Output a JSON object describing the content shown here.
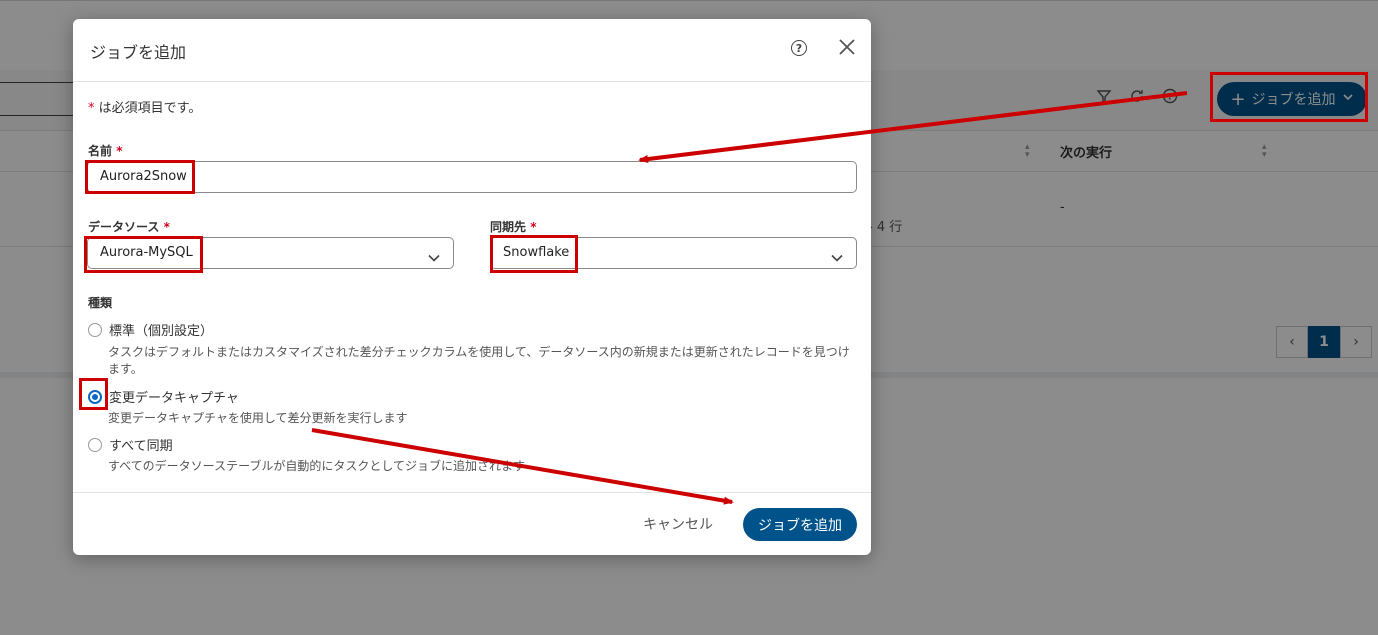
{
  "background": {
    "toolbar": {
      "add_job_label": "ジョブを追加"
    },
    "table": {
      "next_run_header": "次の実行",
      "next_run_value": "-",
      "rows_text": "- 4 行"
    },
    "pagination": {
      "prev": "‹",
      "current_page": "1",
      "next": "›"
    }
  },
  "modal": {
    "title": "ジョブを追加",
    "required_note": {
      "mark": "*",
      "text": " は必須項目です。"
    },
    "fields": {
      "name": {
        "label": "名前",
        "required_mark": "*",
        "value": "Aurora2Snow"
      },
      "data_source": {
        "label": "データソース",
        "required_mark": "*",
        "value": "Aurora-MySQL"
      },
      "destination": {
        "label": "同期先",
        "required_mark": "*",
        "value": "Snowflake"
      }
    },
    "type": {
      "label": "種類",
      "options": [
        {
          "label": "標準（個別設定）",
          "description": "タスクはデフォルトまたはカスタマイズされた差分チェックカラムを使用して、データソース内の新規または更新されたレコードを見つけます。",
          "selected": false
        },
        {
          "label": "変更データキャプチャ",
          "description": "変更データキャプチャを使用して差分更新を実行します",
          "selected": true
        },
        {
          "label": "すべて同期",
          "description": "すべてのデータソーステーブルが自動的にタスクとしてジョブに追加されます",
          "selected": false
        }
      ]
    },
    "footer": {
      "cancel_label": "キャンセル",
      "submit_label": "ジョブを追加"
    }
  },
  "colors": {
    "primary": "#00538a",
    "annotation": "#cc0000",
    "radio_selected": "#0a66c2"
  }
}
